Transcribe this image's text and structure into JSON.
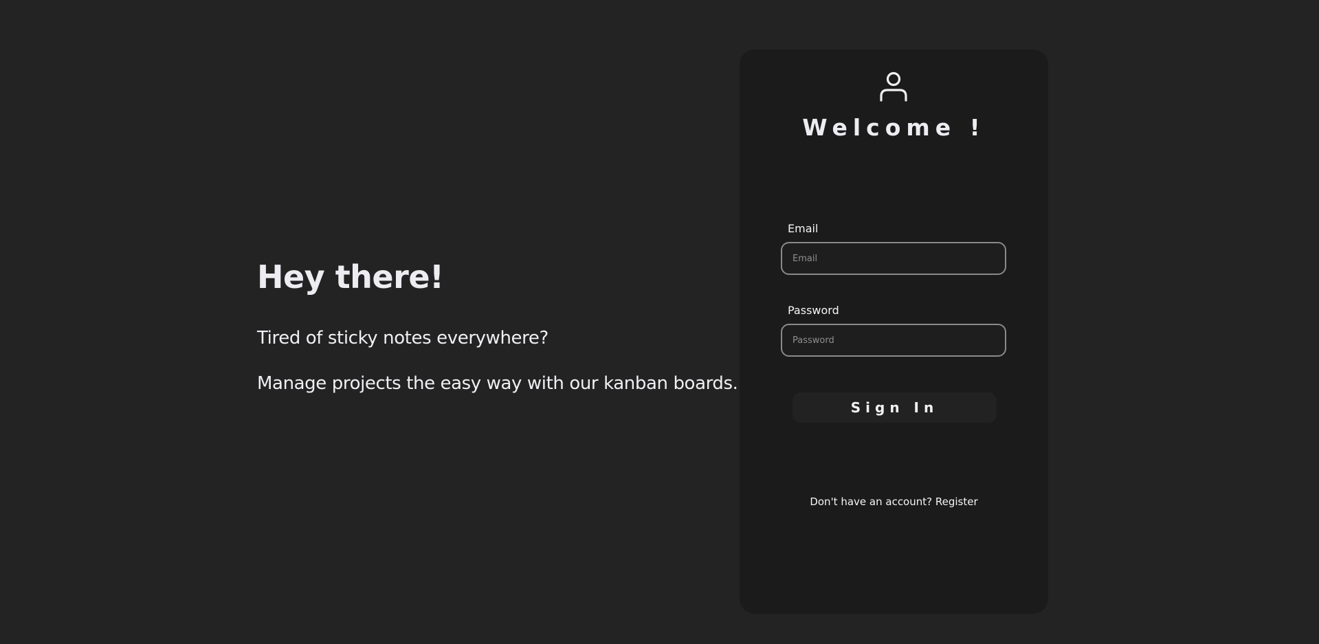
{
  "intro": {
    "heading": "Hey there!",
    "line1": "Tired of sticky notes everywhere?",
    "line2": "Manage projects the easy way with our kanban boards."
  },
  "login_card": {
    "icon": "user-icon",
    "welcome": "Welcome !",
    "email": {
      "label": "Email",
      "placeholder": "Email",
      "value": ""
    },
    "password": {
      "label": "Password",
      "placeholder": "Password",
      "value": ""
    },
    "sign_in_label": "Sign In",
    "register_prompt": "Don't have an account?",
    "register_link": "Register"
  },
  "colors": {
    "page_background": "#232323",
    "card_background": "#1b1b1b",
    "input_border": "#8a8a8a",
    "button_background": "#222222",
    "text": "#ececf1"
  }
}
